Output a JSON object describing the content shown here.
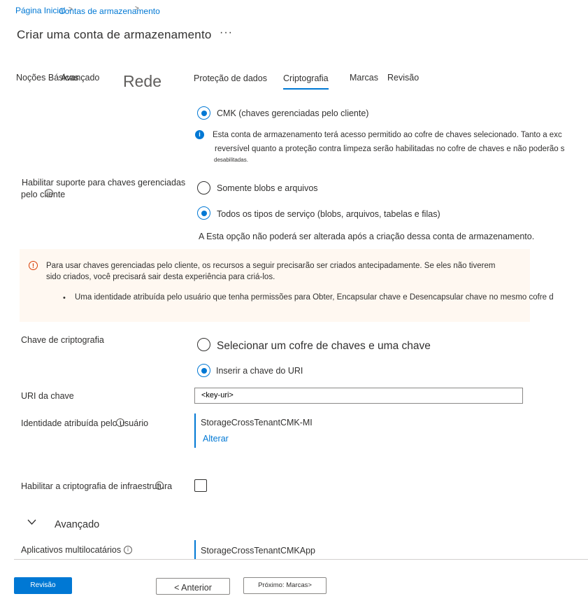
{
  "breadcrumb": {
    "home": "Página Inicial",
    "storage_accounts": "Contas de armazenamento",
    "separator": ">"
  },
  "page": {
    "title": "Criar uma conta de armazenamento",
    "more": "···"
  },
  "tabs": [
    {
      "label": "Noções Básicas"
    },
    {
      "label": "Avançado"
    },
    {
      "label": "Rede"
    },
    {
      "label": "Proteção de dados"
    },
    {
      "label": "Criptografia"
    },
    {
      "label": "Marcas"
    },
    {
      "label": "Revisão"
    }
  ],
  "cmk_option": {
    "label": "CMK (chaves gerenciadas pelo cliente)",
    "info_line1": "Esta conta de armazenamento terá acesso permitido ao cofre de chaves selecionado. Tanto a exc",
    "info_line2": "reversível quanto a proteção contra limpeza serão habilitadas no cofre de chaves e não poderão s",
    "info_line3": "desabilitadas."
  },
  "cmk_support": {
    "label_line1": "Habilitar suporte para chaves gerenciadas",
    "label_line2": "pelo cliente",
    "info_icon": "i",
    "option1": "Somente blobs e arquivos",
    "option2": "Todos os tipos de serviço (blobs, arquivos, tabelas e filas)",
    "note": "A Esta opção não poderá ser alterada após a criação dessa conta de armazenamento."
  },
  "warning": {
    "icon": "!",
    "line1": "Para usar chaves gerenciadas pelo cliente, os recursos a seguir precisarão ser criados antecipadamente. Se eles não tiverem",
    "line2": "sido criados, você precisará sair desta experiência para criá-los.",
    "bullet": "Uma identidade atribuída pelo usuário que tenha permissões para Obter, Encapsular chave e Desencapsular chave no mesmo cofre d"
  },
  "encryption_key": {
    "label": "Chave de criptografia",
    "option1": "Selecionar um cofre de chaves e uma chave",
    "option2": "Inserir a chave do URI"
  },
  "key_uri": {
    "label": "URI da chave",
    "value": "<key-uri>"
  },
  "identity": {
    "label": "Identidade atribuída pelo usuário",
    "info_icon": "i",
    "value": "StorageCrossTenantCMK-MI",
    "change_link": "Alterar"
  },
  "infra_encryption": {
    "label": "Habilitar a criptografia de infraestrutura",
    "info_icon": "i",
    "checked": false
  },
  "advanced": {
    "label": "Avançado"
  },
  "multitenant": {
    "label": "Aplicativos multilocatários",
    "info_icon": "i",
    "value": "StorageCrossTenantCMKApp"
  },
  "footer": {
    "review": "Revisão",
    "previous": "< Anterior",
    "next": "Próximo: Marcas>"
  },
  "colors": {
    "accent": "#0078d4",
    "warning_bg": "#fff8f1",
    "warning_icon": "#d83b01"
  }
}
